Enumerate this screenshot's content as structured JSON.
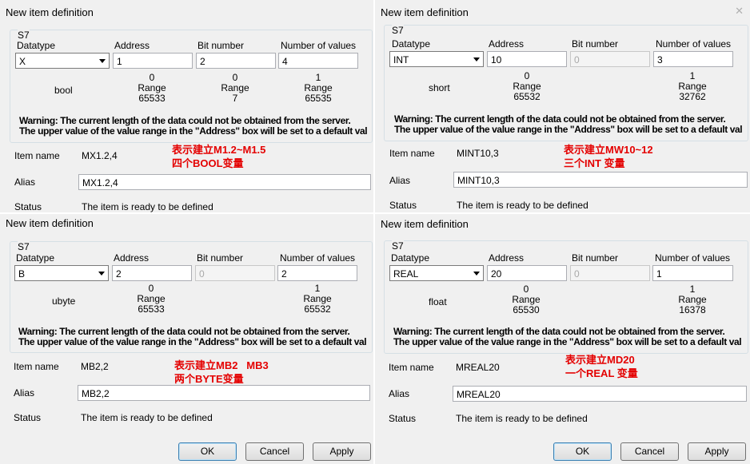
{
  "dialogs": [
    {
      "title": "New item definition",
      "group_label": "S7",
      "datatype": "X",
      "address": "1",
      "bit_number": "2",
      "bit_disabled": false,
      "number_of_values": "4",
      "type_name": "bool",
      "range_address": [
        "0",
        "Range",
        "65533"
      ],
      "range_bit": [
        "0",
        "Range",
        "7"
      ],
      "range_count": [
        "1",
        "Range",
        "65535"
      ],
      "item_name": "MX1.2,4",
      "alias": "MX1.2,4",
      "status": "The item is ready to be defined",
      "note_line1": "表示建立M1.2~M1.5",
      "note_line2": "四个BOOL变量"
    },
    {
      "title": "New item definition",
      "group_label": "S7",
      "datatype": "INT",
      "address": "10",
      "bit_number": "0",
      "bit_disabled": true,
      "number_of_values": "3",
      "type_name": "short",
      "range_address": [
        "0",
        "Range",
        "65532"
      ],
      "range_count": [
        "1",
        "Range",
        "32762"
      ],
      "item_name": "MINT10,3",
      "alias": "MINT10,3",
      "status": "The item is ready to be defined",
      "note_line1": "表示建立MW10~12",
      "note_line2": "三个INT 变量"
    },
    {
      "title": "New item definition",
      "group_label": "S7",
      "datatype": "B",
      "address": "2",
      "bit_number": "0",
      "bit_disabled": true,
      "number_of_values": "2",
      "type_name": "ubyte",
      "range_address": [
        "0",
        "Range",
        "65533"
      ],
      "range_count": [
        "1",
        "Range",
        "65532"
      ],
      "item_name": "MB2,2",
      "alias": "MB2,2",
      "status": "The item is ready to be defined",
      "note_line1": "表示建立MB2   MB3",
      "note_line2": "两个BYTE变量"
    },
    {
      "title": "New item definition",
      "group_label": "S7",
      "datatype": "REAL",
      "address": "20",
      "bit_number": "0",
      "bit_disabled": true,
      "number_of_values": "1",
      "type_name": "float",
      "range_address": [
        "0",
        "Range",
        "65530"
      ],
      "range_count": [
        "1",
        "Range",
        "16378"
      ],
      "item_name": "MREAL20",
      "alias": "MREAL20",
      "status": "The item is ready to be defined",
      "note_line1": "表示建立MD20",
      "note_line2": "一个REAL 变量"
    }
  ],
  "labels": {
    "datatype": "Datatype",
    "address": "Address",
    "bit_number": "Bit number",
    "number_of_values": "Number of values",
    "item_name": "Item name",
    "alias": "Alias",
    "status": "Status",
    "warning_line1": "Warning: The current length of the data could not be obtained from the server.",
    "warning_line2": "The upper value of the value range in the \"Address\" box will be set to a default val"
  },
  "buttons": {
    "ok": "OK",
    "cancel": "Cancel",
    "apply": "Apply"
  },
  "colors": {
    "note": "#e40000",
    "panel_bg": "#f0f0f0"
  }
}
